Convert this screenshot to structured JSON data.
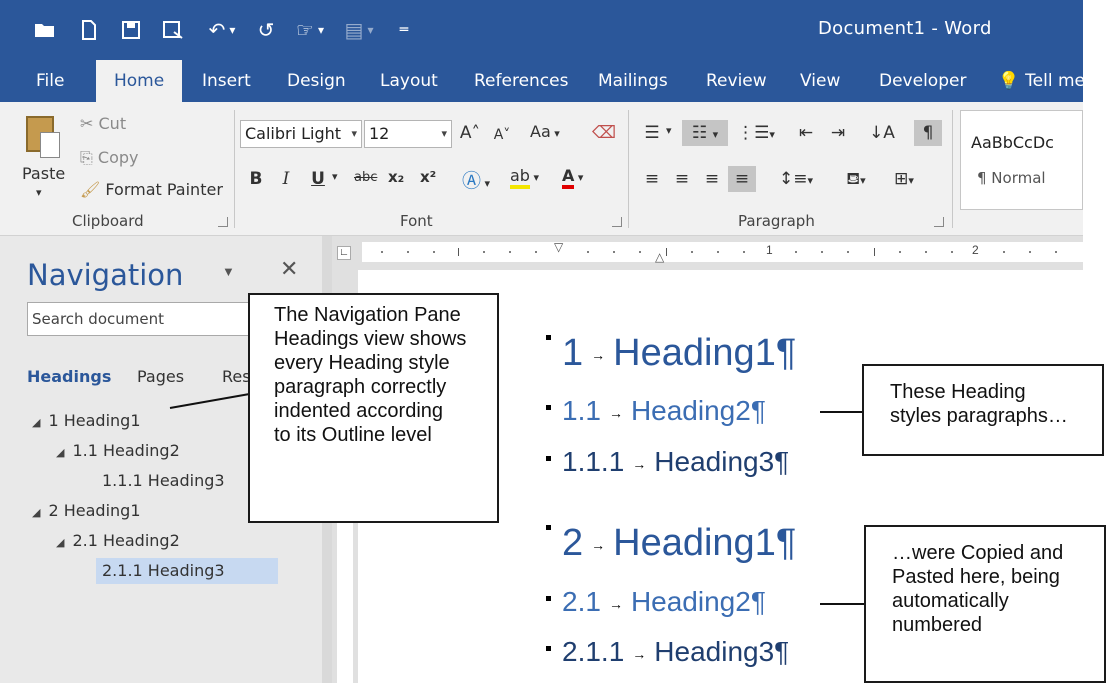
{
  "window": {
    "title": "Document1  -  Word"
  },
  "quick_access": [
    {
      "name": "open-icon",
      "glyph": "📂"
    },
    {
      "name": "new-icon",
      "glyph": "🗋"
    },
    {
      "name": "save-icon",
      "glyph": "🖫"
    },
    {
      "name": "save-as-icon",
      "glyph": "🗎"
    },
    {
      "name": "undo-icon",
      "glyph": "↶"
    },
    {
      "name": "redo-icon",
      "glyph": "↺"
    },
    {
      "name": "touch-mode-icon",
      "glyph": "☞"
    },
    {
      "name": "insert-icon",
      "glyph": "▤"
    },
    {
      "name": "customize-qat-icon",
      "glyph": "▾"
    }
  ],
  "tabs": [
    "File",
    "Home",
    "Insert",
    "Design",
    "Layout",
    "References",
    "Mailings",
    "Review",
    "View",
    "Developer",
    "Tell me"
  ],
  "ribbon": {
    "clipboard": {
      "paste": "Paste",
      "cut": "Cut",
      "copy": "Copy",
      "format_painter": "Format Painter",
      "label": "Clipboard"
    },
    "font": {
      "font_name": "Calibri Light",
      "font_size": "12",
      "grow": "A˄",
      "shrink": "A˅",
      "change_case": "Aa",
      "bold": "B",
      "italic": "I",
      "underline": "U",
      "strikethrough": "abc",
      "subscript": "x₂",
      "superscript": "x²",
      "label": "Font"
    },
    "paragraph": {
      "label": "Paragraph"
    },
    "styles": {
      "sample": "AaBbCcDc",
      "normal": "¶ Normal"
    }
  },
  "navigation": {
    "title": "Navigation",
    "search_placeholder": "Search document",
    "tabs": [
      "Headings",
      "Pages",
      "Res"
    ],
    "items": [
      {
        "label": "1 Heading1",
        "level": 1,
        "expander": "◢"
      },
      {
        "label": "1.1 Heading2",
        "level": 2,
        "expander": "◢"
      },
      {
        "label": "1.1.1 Heading3",
        "level": 3,
        "expander": ""
      },
      {
        "label": "2 Heading1",
        "level": 1,
        "expander": "◢"
      },
      {
        "label": "2.1 Heading2",
        "level": 2,
        "expander": "◢"
      },
      {
        "label": "2.1.1 Heading3",
        "level": 3,
        "expander": "",
        "selected": true
      }
    ]
  },
  "ruler": {
    "marks": [
      "1",
      "2"
    ]
  },
  "document": {
    "headings": [
      {
        "num": "1",
        "text": "Heading1¶",
        "level": 1
      },
      {
        "num": "1.1",
        "text": "Heading2¶",
        "level": 2
      },
      {
        "num": "1.1.1",
        "text": "Heading3¶",
        "level": 3
      },
      {
        "num": "2",
        "text": "Heading1¶",
        "level": 1
      },
      {
        "num": "2.1",
        "text": "Heading2¶",
        "level": 2
      },
      {
        "num": "2.1.1",
        "text": "Heading3¶",
        "level": 3
      }
    ],
    "arrow": "→"
  },
  "callouts": {
    "nav": [
      "The Navigation Pane",
      "Headings view shows",
      "every Heading style",
      "paragraph correctly",
      "indented according",
      "to its Outline level"
    ],
    "top": [
      "These Heading",
      "styles paragraphs…"
    ],
    "bottom": [
      "…were Copied and",
      "Pasted here, being",
      "automatically",
      "numbered"
    ]
  }
}
